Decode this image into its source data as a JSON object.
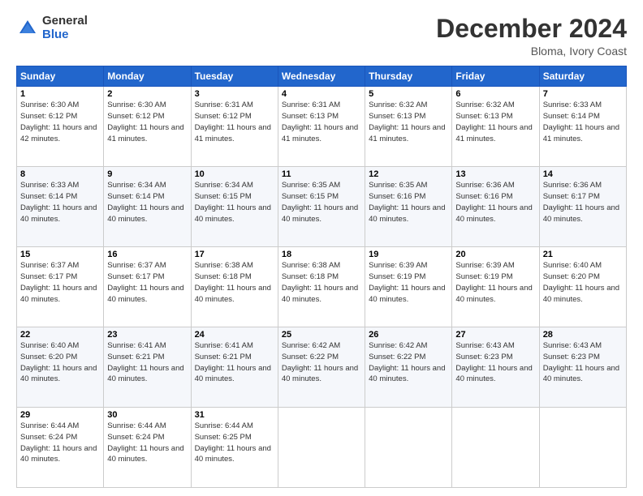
{
  "logo": {
    "general": "General",
    "blue": "Blue"
  },
  "title": "December 2024",
  "location": "Bloma, Ivory Coast",
  "days_of_week": [
    "Sunday",
    "Monday",
    "Tuesday",
    "Wednesday",
    "Thursday",
    "Friday",
    "Saturday"
  ],
  "weeks": [
    [
      {
        "day": "1",
        "sunrise": "6:30 AM",
        "sunset": "6:12 PM",
        "daylight": "11 hours and 42 minutes."
      },
      {
        "day": "2",
        "sunrise": "6:30 AM",
        "sunset": "6:12 PM",
        "daylight": "11 hours and 41 minutes."
      },
      {
        "day": "3",
        "sunrise": "6:31 AM",
        "sunset": "6:12 PM",
        "daylight": "11 hours and 41 minutes."
      },
      {
        "day": "4",
        "sunrise": "6:31 AM",
        "sunset": "6:13 PM",
        "daylight": "11 hours and 41 minutes."
      },
      {
        "day": "5",
        "sunrise": "6:32 AM",
        "sunset": "6:13 PM",
        "daylight": "11 hours and 41 minutes."
      },
      {
        "day": "6",
        "sunrise": "6:32 AM",
        "sunset": "6:13 PM",
        "daylight": "11 hours and 41 minutes."
      },
      {
        "day": "7",
        "sunrise": "6:33 AM",
        "sunset": "6:14 PM",
        "daylight": "11 hours and 41 minutes."
      }
    ],
    [
      {
        "day": "8",
        "sunrise": "6:33 AM",
        "sunset": "6:14 PM",
        "daylight": "11 hours and 40 minutes."
      },
      {
        "day": "9",
        "sunrise": "6:34 AM",
        "sunset": "6:14 PM",
        "daylight": "11 hours and 40 minutes."
      },
      {
        "day": "10",
        "sunrise": "6:34 AM",
        "sunset": "6:15 PM",
        "daylight": "11 hours and 40 minutes."
      },
      {
        "day": "11",
        "sunrise": "6:35 AM",
        "sunset": "6:15 PM",
        "daylight": "11 hours and 40 minutes."
      },
      {
        "day": "12",
        "sunrise": "6:35 AM",
        "sunset": "6:16 PM",
        "daylight": "11 hours and 40 minutes."
      },
      {
        "day": "13",
        "sunrise": "6:36 AM",
        "sunset": "6:16 PM",
        "daylight": "11 hours and 40 minutes."
      },
      {
        "day": "14",
        "sunrise": "6:36 AM",
        "sunset": "6:17 PM",
        "daylight": "11 hours and 40 minutes."
      }
    ],
    [
      {
        "day": "15",
        "sunrise": "6:37 AM",
        "sunset": "6:17 PM",
        "daylight": "11 hours and 40 minutes."
      },
      {
        "day": "16",
        "sunrise": "6:37 AM",
        "sunset": "6:17 PM",
        "daylight": "11 hours and 40 minutes."
      },
      {
        "day": "17",
        "sunrise": "6:38 AM",
        "sunset": "6:18 PM",
        "daylight": "11 hours and 40 minutes."
      },
      {
        "day": "18",
        "sunrise": "6:38 AM",
        "sunset": "6:18 PM",
        "daylight": "11 hours and 40 minutes."
      },
      {
        "day": "19",
        "sunrise": "6:39 AM",
        "sunset": "6:19 PM",
        "daylight": "11 hours and 40 minutes."
      },
      {
        "day": "20",
        "sunrise": "6:39 AM",
        "sunset": "6:19 PM",
        "daylight": "11 hours and 40 minutes."
      },
      {
        "day": "21",
        "sunrise": "6:40 AM",
        "sunset": "6:20 PM",
        "daylight": "11 hours and 40 minutes."
      }
    ],
    [
      {
        "day": "22",
        "sunrise": "6:40 AM",
        "sunset": "6:20 PM",
        "daylight": "11 hours and 40 minutes."
      },
      {
        "day": "23",
        "sunrise": "6:41 AM",
        "sunset": "6:21 PM",
        "daylight": "11 hours and 40 minutes."
      },
      {
        "day": "24",
        "sunrise": "6:41 AM",
        "sunset": "6:21 PM",
        "daylight": "11 hours and 40 minutes."
      },
      {
        "day": "25",
        "sunrise": "6:42 AM",
        "sunset": "6:22 PM",
        "daylight": "11 hours and 40 minutes."
      },
      {
        "day": "26",
        "sunrise": "6:42 AM",
        "sunset": "6:22 PM",
        "daylight": "11 hours and 40 minutes."
      },
      {
        "day": "27",
        "sunrise": "6:43 AM",
        "sunset": "6:23 PM",
        "daylight": "11 hours and 40 minutes."
      },
      {
        "day": "28",
        "sunrise": "6:43 AM",
        "sunset": "6:23 PM",
        "daylight": "11 hours and 40 minutes."
      }
    ],
    [
      {
        "day": "29",
        "sunrise": "6:44 AM",
        "sunset": "6:24 PM",
        "daylight": "11 hours and 40 minutes."
      },
      {
        "day": "30",
        "sunrise": "6:44 AM",
        "sunset": "6:24 PM",
        "daylight": "11 hours and 40 minutes."
      },
      {
        "day": "31",
        "sunrise": "6:44 AM",
        "sunset": "6:25 PM",
        "daylight": "11 hours and 40 minutes."
      },
      null,
      null,
      null,
      null
    ]
  ]
}
